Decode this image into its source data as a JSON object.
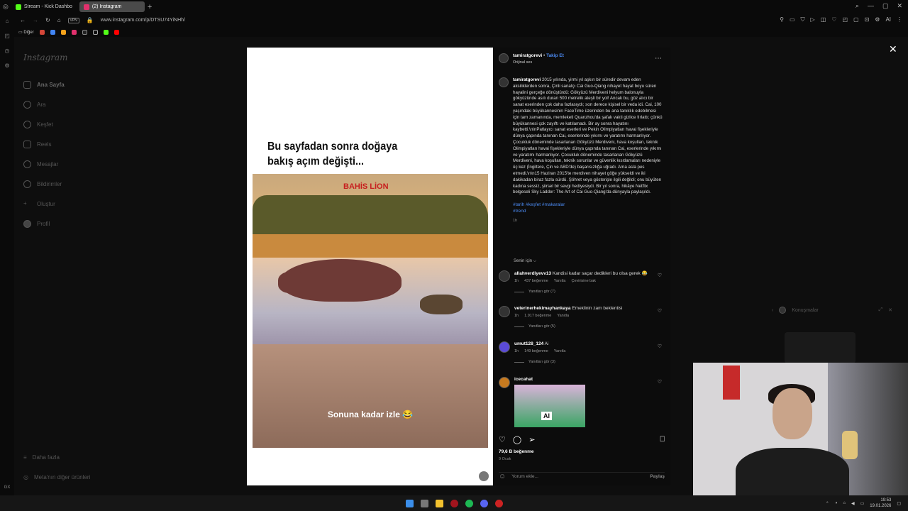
{
  "browser": {
    "tabs": [
      {
        "label": "Stream - Kick Dashbo",
        "color": "#53fc18"
      },
      {
        "label": "(2) Instagram",
        "color": "#e1306c"
      }
    ],
    "new_tab": "+",
    "vpn": "VPN",
    "url": "www.instagram.com/p/DTSU74YiNHh/",
    "ai_label": "AI",
    "bookmarks_folder": "Diğer"
  },
  "instagram_nav": {
    "logo": "Instagram",
    "items": [
      {
        "label": "Ana Sayfa",
        "icon": "home-icon"
      },
      {
        "label": "Ara",
        "icon": "search-icon"
      },
      {
        "label": "Keşfet",
        "icon": "compass-icon"
      },
      {
        "label": "Reels",
        "icon": "reels-icon"
      },
      {
        "label": "Mesajlar",
        "icon": "messenger-icon"
      },
      {
        "label": "Bildirimler",
        "icon": "heart-icon"
      },
      {
        "label": "Oluştur",
        "icon": "plus-icon"
      },
      {
        "label": "Profil",
        "icon": "avatar-icon"
      }
    ],
    "more": "Daha fazla",
    "meta": "Meta'nın diğer ürünleri"
  },
  "media": {
    "title_line1": "Bu sayfadan sonra doğaya",
    "title_line2": "bakış açım değişti...",
    "brand": "BAHİS LİON",
    "caption": "Sonuna kadar izle 😂"
  },
  "post": {
    "username": "tamiratgorevi",
    "follow": "Takip Et",
    "audio": "Orijinal ses",
    "caption_user": "tamiratgorevi",
    "caption": "2015 yılında, yirmi yıl aşkın bir süredir devam eden aksiliklerden sonra, Çinli sanatçı Cai Guo-Qiang nihayet hayat boyu süren hayalini gerçeğe dönüştürdü: Gökyüzü Merdiveni helyum balonuyla gökyüzünde asılı duran 500 metrelik ateşli bir yol! Ancak bu, göz alıcı bir sanat eserinden çok daha fazlasıydı; son derece kişisel bir veda idi. Cai, 100 yaşındaki büyükannesinin FaceTime üzerinden bu ana tanıklık edebilmesi için tam zamanında, memleketi Quanzhou'da şafak vakti gizlice fırlattı; çünkü büyükannesi çok zayıftı ve katılamadı. Bir ay sonra hayatını kaybetti.\\n\\nPatlayıcı sanat eserleri ve Pekin Olimpiyatları havai fişekleriyle dünya çapında tanınan Cai, eserlerinde yıkımı ve yaratımı harmanlıyor. Çocukluk döneminde tasarlanan Gökyüzü Merdiveni, hava koşulları, teknik Olimpiyatları havai fişekleriyle dünya çapında tanınan Cai, eserlerinde yıkımı ve yaratımı harmanlıyor. Çocukluk döneminde tasarlanan Gökyüzü Merdiveni, hava koşulları, teknik sorunlar ve güvenlik kısıtlamaları nedeniyle üç kez (İngiltere, Çin ve ABD'de) başarısızlığa uğradı. Ama asla pes etmedi.\\n\\n15 Haziran 2015'te merdiven nihayet göğe yükseldi ve iki dakikadan biraz fazla sürdü. Şöhret veya gösterişle ilgili değildi; onu büyüten kadına sessiz, şiirsel bir sevgi hediyesiydi. Bir yıl sonra, hikâye Netflix belgeseli Sky Ladder: The Art of Cai Guo-Qiang'da dünyayla paylaşıldı.",
    "hashtags_line1": "#tarih #keşfet #makaralar",
    "hashtags_line2": "#trend",
    "caption_time": "1h",
    "for_you": "Senin için ⌵",
    "likes": "79,6 B beğenme",
    "date": "9 Ocak",
    "add_comment_placeholder": "Yorum ekle...",
    "share": "Paylaş"
  },
  "comments": [
    {
      "user": "allahverdiyevv13",
      "text": "Kandisi kadar saçar dedikleri bu olsa gerek 😂",
      "time": "1h",
      "likes": "437 beğenme",
      "reply": "Yanıtla",
      "translate": "Çevirisine bak",
      "replies": "Yanıtları gör (7)"
    },
    {
      "user": "veterinerhekimayhankaya",
      "text": "Emeklinin zam beklentisi",
      "time": "1h",
      "likes": "1.917 beğenme",
      "reply": "Yanıtla",
      "translate": "",
      "replies": "Yanıtları gör (5)"
    },
    {
      "user": "umut128_124",
      "text": "Ai",
      "time": "1h",
      "likes": "149 beğenme",
      "reply": "Yanıtla",
      "translate": "",
      "replies": "Yanıtları gör (3)"
    },
    {
      "user": "icecahat",
      "text": "",
      "time": "",
      "likes": "",
      "reply": "",
      "translate": "",
      "replies": ""
    }
  ],
  "gif_label": "AI",
  "messages_popup": {
    "title": "Konuşmalar"
  },
  "taskbar": {
    "time": "19:53",
    "date": "19.01.2026"
  },
  "colors": {
    "link_blue": "#4c8cf5",
    "kick_green": "#53fc18",
    "instagram_pink": "#e1306c"
  }
}
